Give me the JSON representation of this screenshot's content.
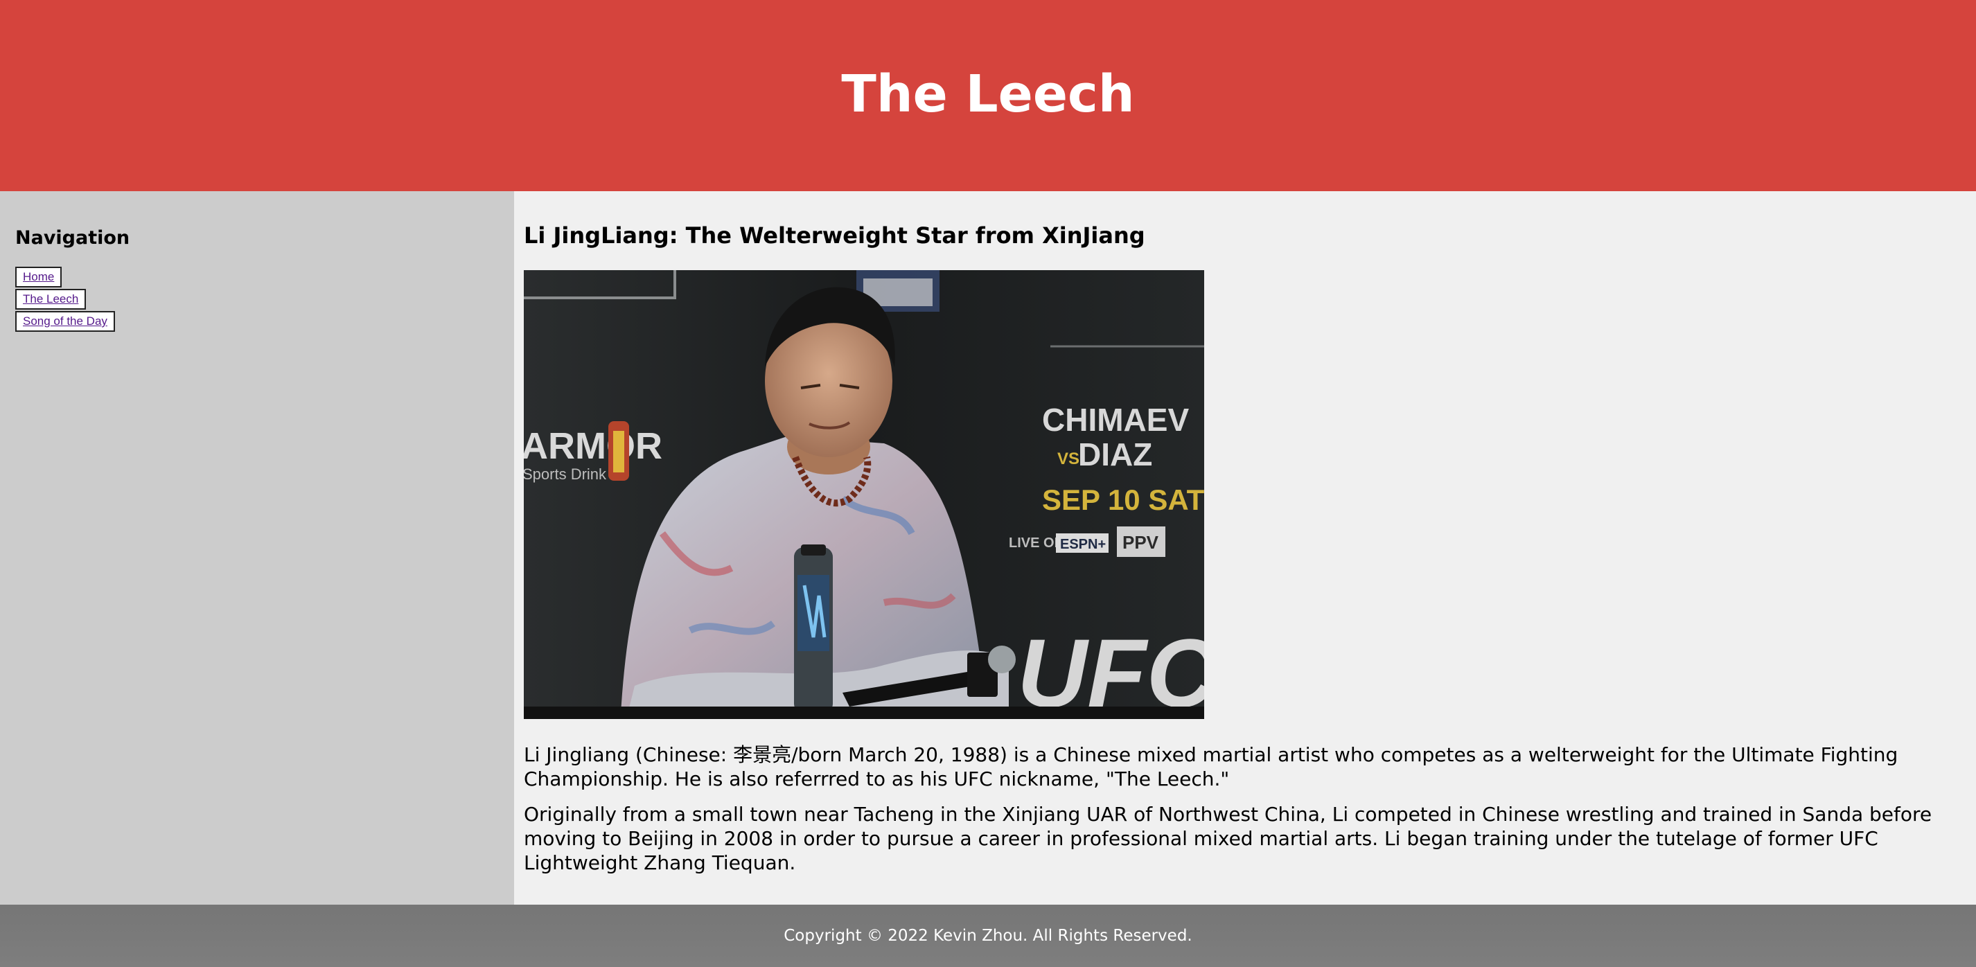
{
  "header": {
    "title": "The Leech"
  },
  "sidebar": {
    "heading": "Navigation",
    "items": [
      {
        "label": "Home"
      },
      {
        "label": "The Leech"
      },
      {
        "label": "Song of the Day"
      }
    ]
  },
  "main": {
    "heading": "Li JingLiang: The Welterweight Star from XinJiang",
    "photo": {
      "backdrop_words": [
        "ARMOR",
        "Sports Drink",
        "CHIMAEV",
        "VS",
        "DIAZ",
        "SEP 10 SAT",
        "LIVE ON",
        "ESPN+",
        "PPV",
        "UFC"
      ]
    },
    "paragraphs": [
      "Li Jingliang (Chinese: 李景亮/born March 20, 1988) is a Chinese mixed martial artist who competes as a welterweight for the Ultimate Fighting Championship. He is also referrred to as his UFC nickname, \"The Leech.\"",
      "Originally from a small town near Tacheng in the Xinjiang UAR of Northwest China, Li competed in Chinese wrestling and trained in Sanda before moving to Beijing in 2008 in order to pursue a career in professional mixed martial arts. Li began training under the tutelage of former UFC Lightweight Zhang Tiequan."
    ]
  },
  "footer": {
    "copyright": "Copyright © 2022 Kevin Zhou. All Rights Reserved."
  },
  "colors": {
    "header_bg": "#d5443d",
    "sidebar_bg": "#cccccc",
    "main_bg": "#f0f0f0",
    "footer_bg": "#7a7a7a",
    "link": "#551a8b"
  }
}
